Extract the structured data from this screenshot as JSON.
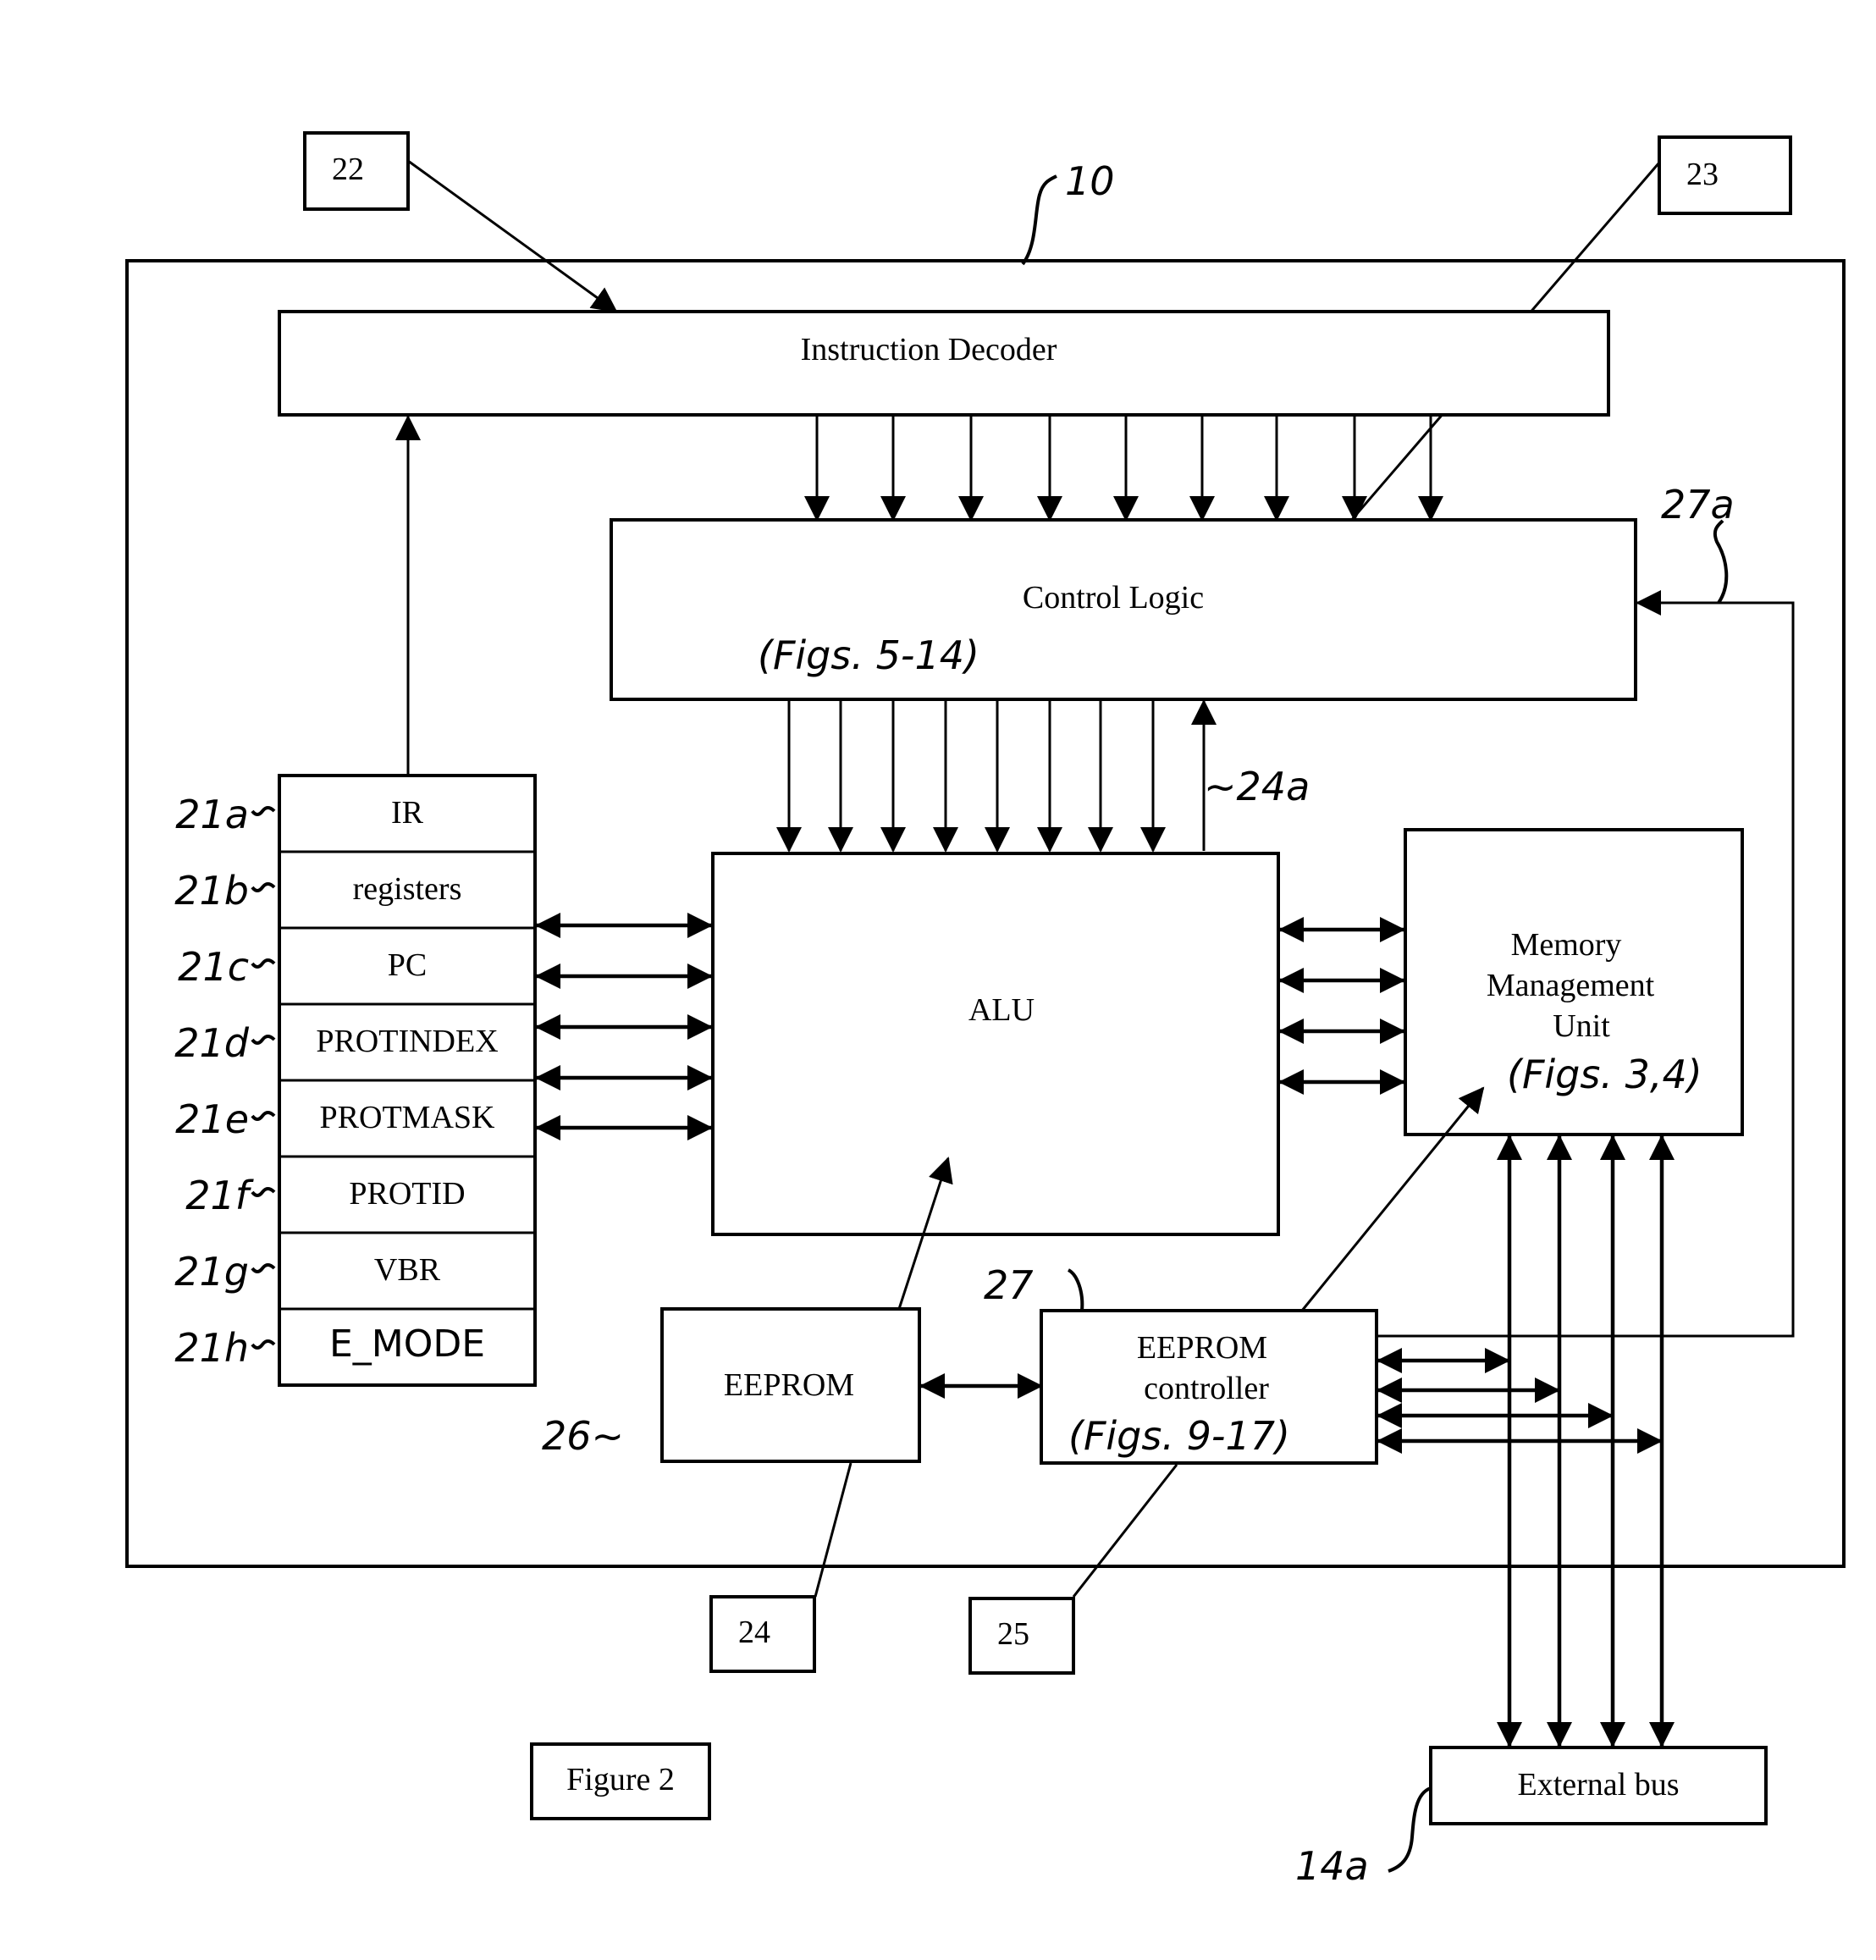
{
  "figure": {
    "caption": "Figure 2",
    "chip_ref": "10"
  },
  "blocks": {
    "instruction_decoder": "Instruction Decoder",
    "control_logic": "Control Logic",
    "control_logic_ref": "(Figs. 5-14)",
    "alu": "ALU",
    "mmu_line1": "Memory",
    "mmu_line2": "Management",
    "mmu_line3": "Unit",
    "mmu_ref": "(Figs. 3,4)",
    "eeprom": "EEPROM",
    "eeprom_controller_line1": "EEPROM",
    "eeprom_controller_line2": "controller",
    "eeprom_controller_ref": "(Figs. 9-17)",
    "external_bus": "External bus"
  },
  "registers": [
    {
      "name": "IR",
      "ref": "21a"
    },
    {
      "name": "registers",
      "ref": "21b"
    },
    {
      "name": "PC",
      "ref": "21c"
    },
    {
      "name": "PROTINDEX",
      "ref": "21d"
    },
    {
      "name": "PROTMASK",
      "ref": "21e"
    },
    {
      "name": "PROTID",
      "ref": "21f"
    },
    {
      "name": "VBR",
      "ref": "21g"
    },
    {
      "name": "E_MODE",
      "ref": "21h"
    }
  ],
  "callouts": {
    "c22": "22",
    "c23": "23",
    "c24": "24",
    "c25": "25"
  },
  "refs": {
    "r24a": "~24a",
    "r27a": "27a",
    "r27": "27",
    "r26": "26~",
    "r14a": "14a"
  }
}
